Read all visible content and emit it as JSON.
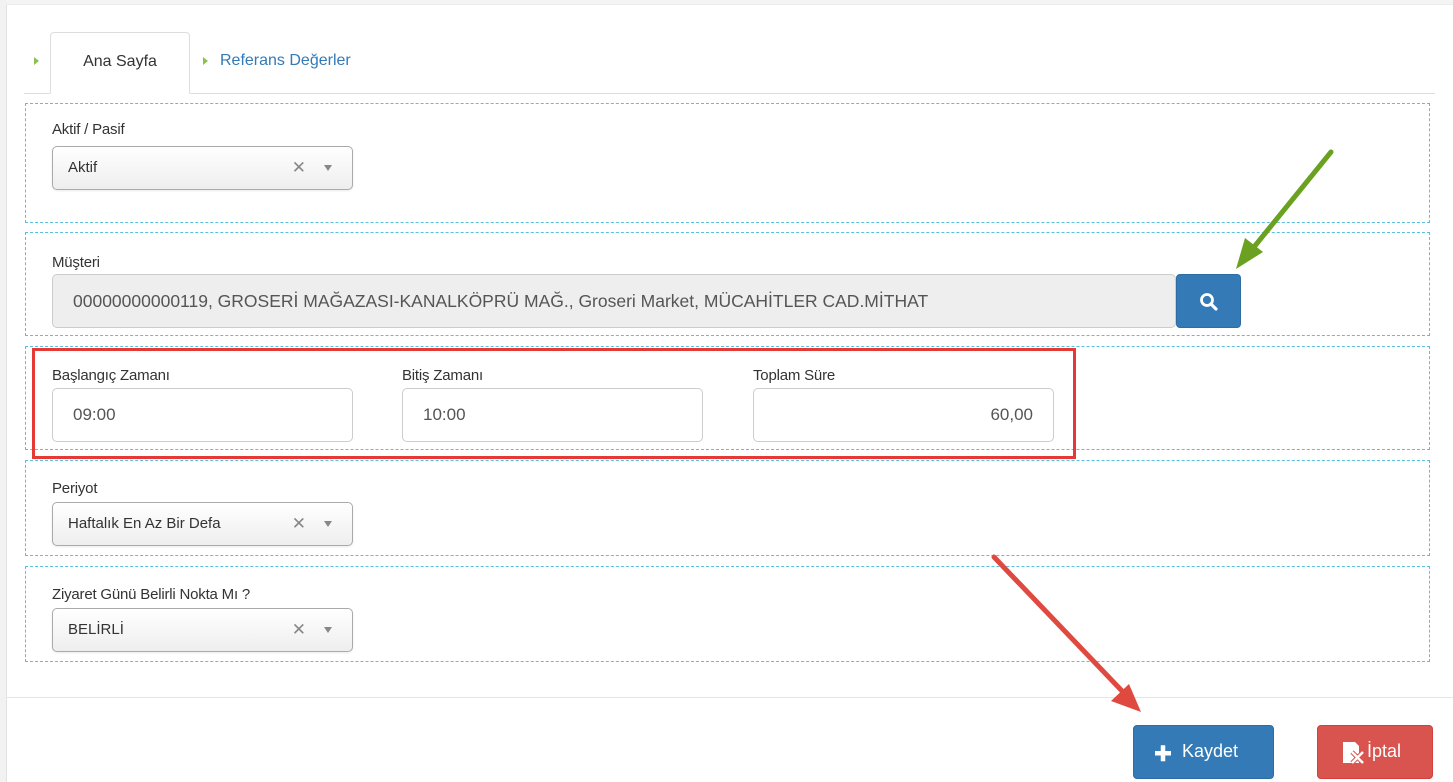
{
  "tabs": [
    {
      "label": "Ana Sayfa"
    },
    {
      "label": "Referans Değerler"
    }
  ],
  "status_field": {
    "label": "Aktif / Pasif",
    "value": "Aktif"
  },
  "customer_field": {
    "label": "Müşteri",
    "value": "00000000000119, GROSERİ  MAĞAZASI-KANALKÖPRÜ MAĞ., Groseri Market, MÜCAHİTLER CAD.MİTHAT"
  },
  "time_fields": {
    "start": {
      "label": "Başlangıç Zamanı",
      "value": "09:00"
    },
    "end": {
      "label": "Bitiş Zamanı",
      "value": "10:00"
    },
    "total": {
      "label": "Toplam Süre",
      "value": "60,00"
    }
  },
  "period_field": {
    "label": "Periyot",
    "value": "Haftalık En Az Bir Defa"
  },
  "visit_day_field": {
    "label": "Ziyaret Günü Belirli Nokta Mı ?",
    "value": "BELİRLİ"
  },
  "actions": {
    "save_label": "Kaydet",
    "cancel_label": "İptal"
  },
  "colors": {
    "primary": "#337ab7",
    "danger": "#d9534f",
    "tab_caret": "#8cc152",
    "section_border": "#5bc0de",
    "highlight_box": "#e53935",
    "annotation_green": "#6aa121",
    "annotation_red": "#e0493f"
  },
  "icons": {
    "search": "search-icon",
    "plus": "plus-icon",
    "cancel": "cancel-file-icon",
    "clear": "clear-x-icon",
    "arrow": "dropdown-arrow-icon"
  }
}
